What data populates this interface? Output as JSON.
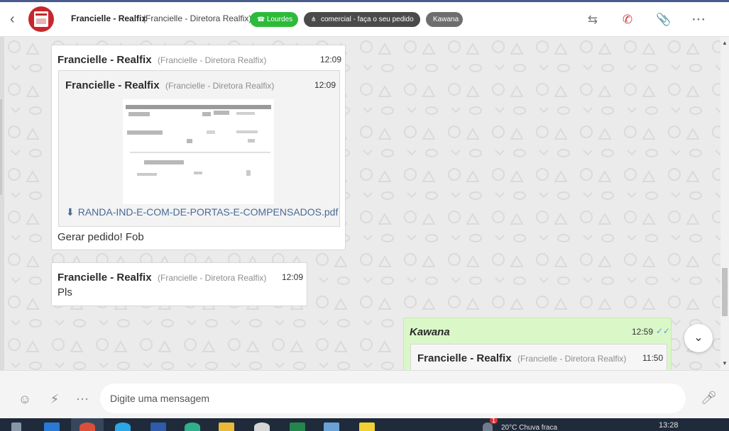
{
  "header": {
    "back_icon": "chevron-left-icon",
    "contact_name": "Francielle - Realfix",
    "contact_sub": "(Francielle - Diretora Realfix)",
    "tags": [
      {
        "label": "Lourdes",
        "icon": "whatsapp-icon",
        "color": "#2dba3a"
      },
      {
        "label": "comercial - faça o seu pedido",
        "icon": "sitemap-icon",
        "color": "#4a4a4a"
      },
      {
        "label": "Kawana",
        "color": "#6e6e6e"
      }
    ],
    "actions": [
      "transfer-icon",
      "end-call-icon",
      "paperclip-icon",
      "more-icon"
    ]
  },
  "messages": [
    {
      "sender": "Francielle - Realfix",
      "sender_sub": "(Francielle - Diretora Realfix)",
      "time": "12:09",
      "quoted": {
        "sender": "Francielle - Realfix",
        "sender_sub": "(Francielle - Diretora Realfix)",
        "time": "12:09",
        "attachment": "RANDA-IND-E-COM-DE-PORTAS-E-COMPENSADOS.pdf"
      },
      "text": "Gerar pedido! Fob"
    },
    {
      "sender": "Francielle - Realfix",
      "sender_sub": "(Francielle - Diretora Realfix)",
      "time": "12:09",
      "text": "Pls"
    },
    {
      "sender": "Kawana",
      "time": "12:59",
      "status": "read",
      "quoted": {
        "sender": "Francielle - Realfix",
        "sender_sub": "(Francielle - Diretora Realfix)",
        "time": "11:50"
      }
    }
  ],
  "composer": {
    "placeholder": "Digite uma mensagem",
    "icons": [
      "emoji-icon",
      "bolt-icon",
      "quick-reply-icon",
      "microphone-icon"
    ]
  },
  "taskbar": {
    "status_text": "20°C  Chuva fraca",
    "clock": "13:28",
    "notification_count": "1"
  },
  "colors": {
    "outgoing_bubble": "#daf7c8",
    "accent_green": "#2dba3a",
    "link": "#4a6a99",
    "read_check": "#4aa3df"
  }
}
